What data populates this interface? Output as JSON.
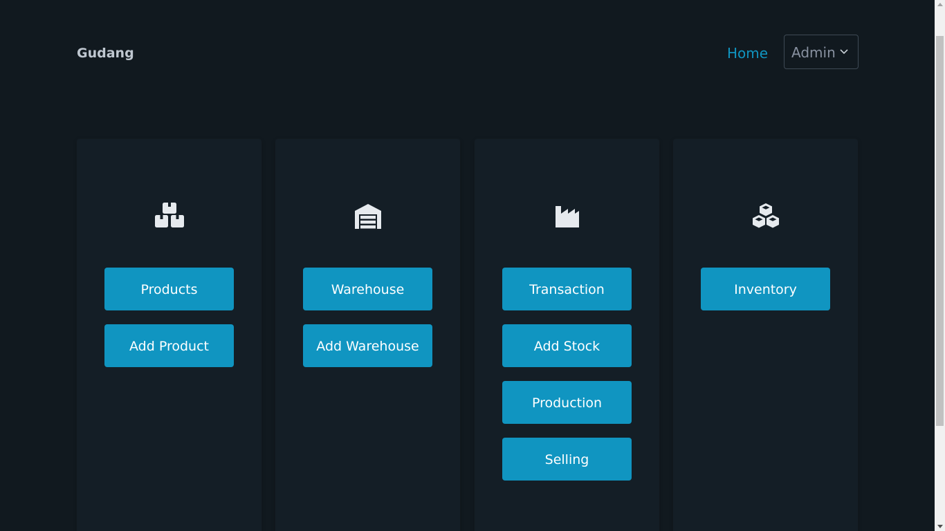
{
  "header": {
    "brand": "Gudang",
    "home_link": "Home",
    "user_menu": {
      "selected": "Admin",
      "chevron_icon": "chevron-down-icon"
    }
  },
  "cards": [
    {
      "icon": "boxes-stacked-icon",
      "buttons": [
        "Products",
        "Add Product"
      ]
    },
    {
      "icon": "warehouse-icon",
      "buttons": [
        "Warehouse",
        "Add Warehouse"
      ]
    },
    {
      "icon": "industry-icon",
      "buttons": [
        "Transaction",
        "Add Stock",
        "Production",
        "Selling"
      ]
    },
    {
      "icon": "cubes-icon",
      "buttons": [
        "Inventory"
      ]
    }
  ],
  "colors": {
    "background": "#11191f",
    "card": "#141e26",
    "accent": "#1095c1",
    "brand_text": "#bfc7d0"
  }
}
